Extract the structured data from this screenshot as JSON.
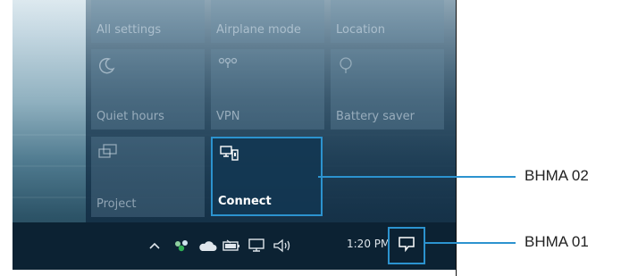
{
  "tiles": {
    "all_settings": "All settings",
    "airplane_mode": "Airplane mode",
    "location": "Location",
    "quiet_hours": "Quiet hours",
    "vpn": "VPN",
    "battery_saver": "Battery saver",
    "project": "Project",
    "connect": "Connect"
  },
  "taskbar": {
    "time": "1:20 PM"
  },
  "callouts": {
    "connect_label": "BHMA 02",
    "notification_label": "BHMA 01"
  },
  "colors": {
    "highlight": "#2c93cf",
    "taskbar": "#0c2233"
  }
}
